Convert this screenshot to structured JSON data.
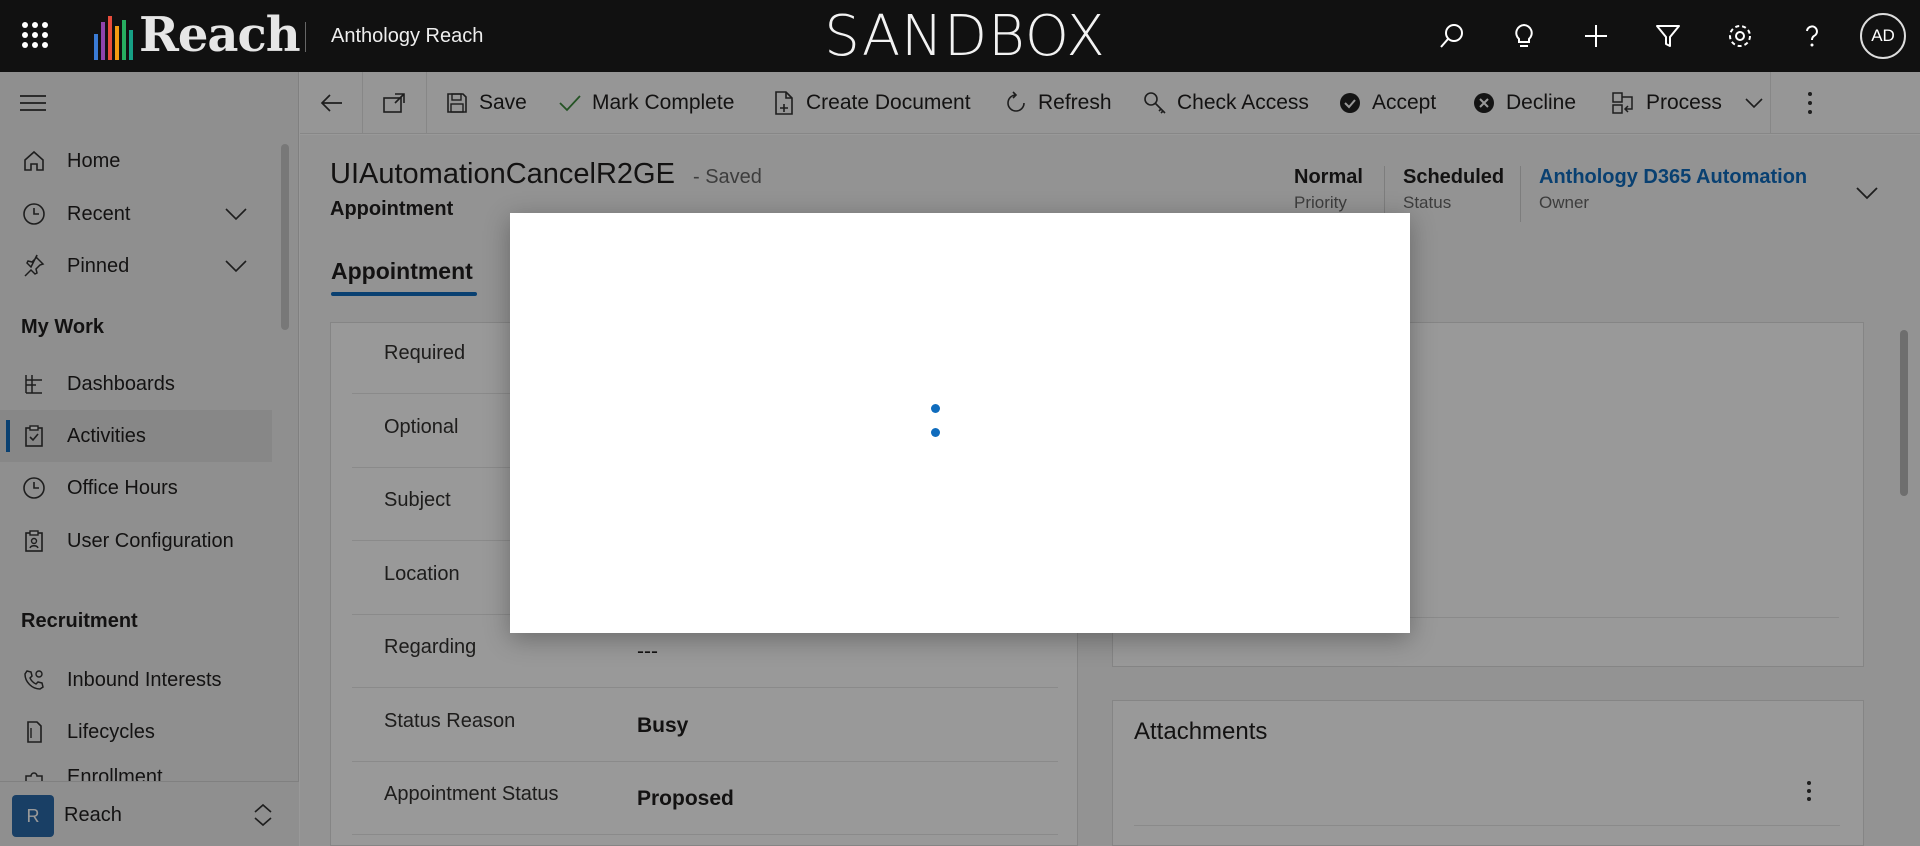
{
  "topbar": {
    "logo_text": "Reach",
    "app_name": "Anthology Reach",
    "environment_banner": "SANDBOX",
    "avatar_initials": "AD",
    "icons": [
      "waffle-icon",
      "search-icon",
      "lightbulb-icon",
      "plus-icon",
      "filter-icon",
      "settings-icon",
      "help-icon"
    ]
  },
  "sidebar": {
    "items": [
      {
        "label": "Home",
        "icon": "home-icon"
      },
      {
        "label": "Recent",
        "icon": "clock-icon"
      },
      {
        "label": "Pinned",
        "icon": "pin-icon"
      }
    ],
    "my_work": {
      "header": "My Work",
      "items": [
        {
          "label": "Dashboards",
          "icon": "dashboard-icon"
        },
        {
          "label": "Activities",
          "icon": "clipboard-icon"
        },
        {
          "label": "Office Hours",
          "icon": "clock-icon"
        },
        {
          "label": "User Configuration",
          "icon": "clipboard-user-icon"
        }
      ]
    },
    "recruitment": {
      "header": "Recruitment",
      "items": [
        {
          "label": "Inbound Interests",
          "icon": "phone-person-icon"
        },
        {
          "label": "Lifecycles",
          "icon": "document-icon"
        },
        {
          "label": "Enrollment",
          "icon": "puzzle-icon"
        }
      ]
    },
    "area": {
      "badge": "R",
      "name": "Reach"
    },
    "active_item": "Activities"
  },
  "commandbar": {
    "save": "Save",
    "mark_complete": "Mark Complete",
    "create_document": "Create Document",
    "refresh": "Refresh",
    "check_access": "Check Access",
    "accept": "Accept",
    "decline": "Decline",
    "process": "Process"
  },
  "record": {
    "title": "UIAutomationCancelR2GE",
    "saved_status": "- Saved",
    "entity": "Appointment",
    "header_fields": [
      {
        "value": "Normal",
        "label": "Priority"
      },
      {
        "value": "Scheduled",
        "label": "Status"
      },
      {
        "value": "Anthology D365 Automation",
        "label": "Owner"
      }
    ],
    "active_tab": "Appointment",
    "fields": [
      {
        "label": "Required",
        "value": ""
      },
      {
        "label": "Optional",
        "value": ""
      },
      {
        "label": "Subject",
        "value": ""
      },
      {
        "label": "Location",
        "value": ""
      },
      {
        "label": "Regarding",
        "value": "---"
      },
      {
        "label": "Status Reason",
        "value": "Busy"
      },
      {
        "label": "Appointment Status",
        "value": "Proposed"
      }
    ],
    "attachments_title": "Attachments"
  },
  "colors": {
    "accent": "#0f6cbd",
    "topbar_bg": "#111111",
    "owner_link": "#0f6cbd"
  }
}
